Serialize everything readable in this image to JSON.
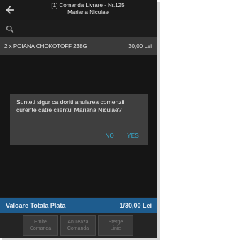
{
  "header": {
    "title_line1": "[1] Comanda Livrare - Nr.125",
    "title_line2": "Mariana Niculae"
  },
  "order_line": {
    "item": "2 x POIANA CHOKOTOFF 238G",
    "amount": "30,00 Lei"
  },
  "dialog": {
    "message": "Sunteti sigur ca doriti anularea comenzii curente catre clientul Mariana Niculae?",
    "no_label": "NO",
    "yes_label": "YES"
  },
  "total": {
    "label": "Valoare Totala Plata",
    "value": "1/30,00 Lei"
  },
  "actions": {
    "emit_line1": "Emite",
    "emit_line2": "Comanda",
    "cancel_line1": "Anuleaza",
    "cancel_line2": "Comanda",
    "delete_line1": "Sterge",
    "delete_line2": "Linie"
  },
  "icons": {
    "back": "back-arrow-icon",
    "search": "search-icon"
  },
  "colors": {
    "accent": "#35b6dc",
    "total_bar": "#1e5c8e",
    "background": "#1c1c1c",
    "dialog": "#3f3f3f"
  }
}
